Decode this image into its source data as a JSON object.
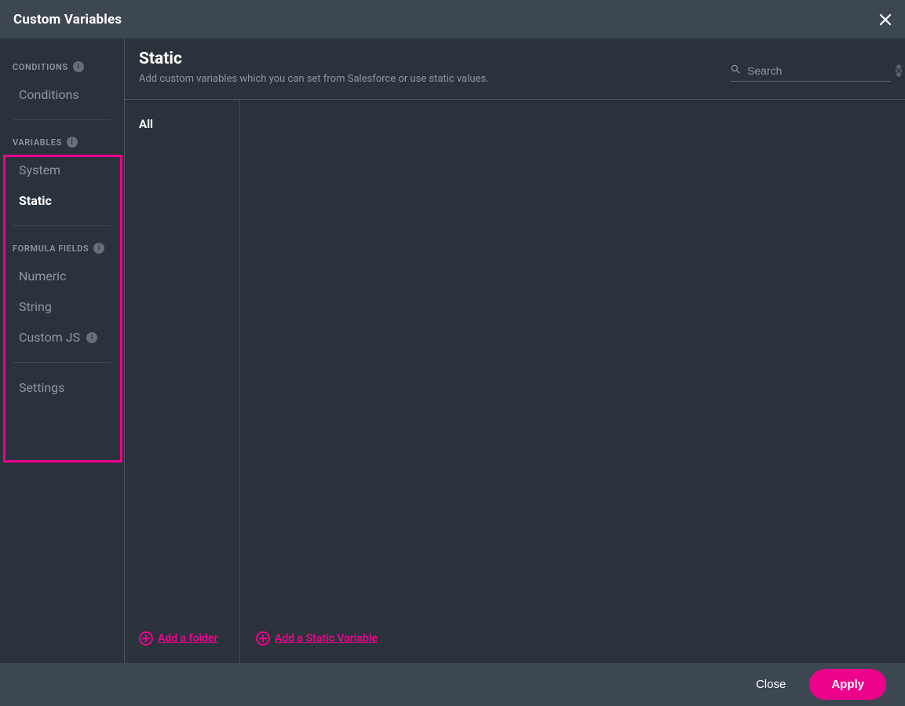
{
  "title": "Custom Variables",
  "sidebar": {
    "sections": [
      {
        "header": "CONDITIONS",
        "has_info": true,
        "items": [
          {
            "label": "Conditions",
            "active": false,
            "has_info": false
          }
        ]
      },
      {
        "header": "VARIABLES",
        "has_info": true,
        "items": [
          {
            "label": "System",
            "active": false,
            "has_info": false
          },
          {
            "label": "Static",
            "active": true,
            "has_info": false
          }
        ]
      },
      {
        "header": "FORMULA FIELDS",
        "has_info": true,
        "items": [
          {
            "label": "Numeric",
            "active": false,
            "has_info": false
          },
          {
            "label": "String",
            "active": false,
            "has_info": false
          },
          {
            "label": "Custom JS",
            "active": false,
            "has_info": true
          }
        ]
      }
    ],
    "settings_label": "Settings"
  },
  "main": {
    "title": "Static",
    "subtitle": "Add custom variables which you can set from Salesforce or use static values.",
    "search_placeholder": "Search",
    "folders": {
      "all_label": "All"
    },
    "actions": {
      "add_folder": "Add a folder",
      "add_variable": "Add a Static Variable"
    }
  },
  "footer": {
    "close": "Close",
    "apply": "Apply"
  },
  "info_glyph": "i"
}
